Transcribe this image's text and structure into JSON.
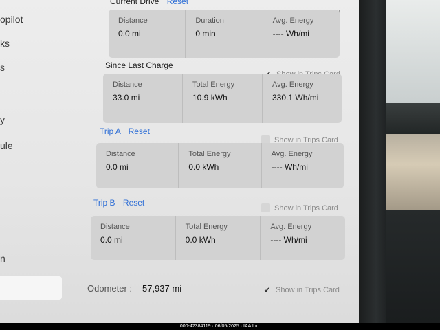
{
  "sidebar": {
    "items": [
      "opilot",
      "ks",
      "s",
      "y",
      "ule",
      "n"
    ]
  },
  "show_card_label": "Show in Trips Card",
  "sections": {
    "current_drive": {
      "title": "Current Drive",
      "reset": "Reset",
      "show_checked": true,
      "cells": [
        {
          "label": "Distance",
          "value": "0.0 mi"
        },
        {
          "label": "Duration",
          "value": "0 min"
        },
        {
          "label": "Avg. Energy",
          "value": "---- Wh/mi"
        }
      ]
    },
    "since_last_charge": {
      "title": "Since Last Charge",
      "show_checked": true,
      "cells": [
        {
          "label": "Distance",
          "value": "33.0 mi"
        },
        {
          "label": "Total Energy",
          "value": "10.9 kWh"
        },
        {
          "label": "Avg. Energy",
          "value": "330.1 Wh/mi"
        }
      ]
    },
    "trip_a": {
      "title": "Trip A",
      "reset": "Reset",
      "show_checked": false,
      "cells": [
        {
          "label": "Distance",
          "value": "0.0 mi"
        },
        {
          "label": "Total Energy",
          "value": "0.0 kWh"
        },
        {
          "label": "Avg. Energy",
          "value": "---- Wh/mi"
        }
      ]
    },
    "trip_b": {
      "title": "Trip B",
      "reset": "Reset",
      "show_checked": false,
      "cells": [
        {
          "label": "Distance",
          "value": "0.0 mi"
        },
        {
          "label": "Total Energy",
          "value": "0.0 kWh"
        },
        {
          "label": "Avg. Energy",
          "value": "---- Wh/mi"
        }
      ]
    }
  },
  "odometer": {
    "label": "Odometer :",
    "value": "57,937 mi",
    "show_checked": true
  },
  "footer": "000-42384119 · 06/05/2025 · IAA Inc.",
  "icons": {
    "checked": "checkmark-icon",
    "unchecked": "empty-checkbox-icon"
  }
}
